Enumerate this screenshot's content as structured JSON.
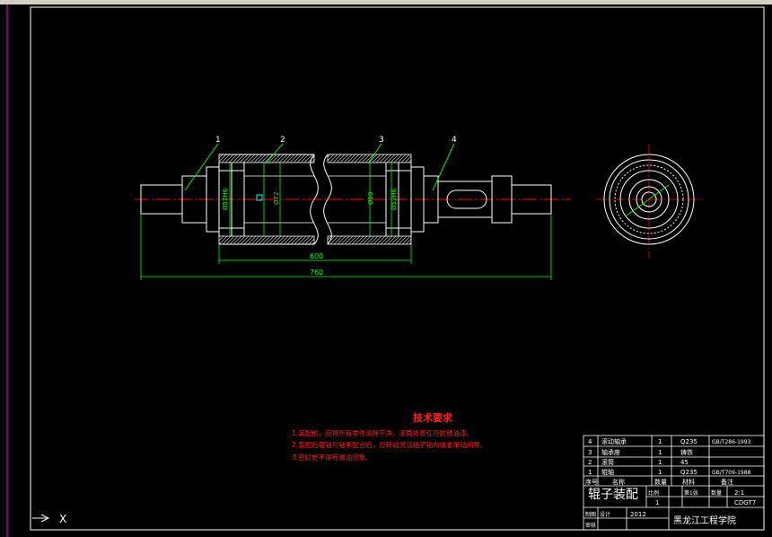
{
  "drawing": {
    "part_numbers": [
      "1",
      "2",
      "3",
      "4"
    ],
    "dimensions": {
      "tube_diameter": "Ø72",
      "left_hub_diameter": "Ø52H6",
      "bore_diameter": "Ø60",
      "right_hub_diameter": "Ø52H6",
      "tube_length": "600",
      "overall_length": "760"
    }
  },
  "requirements": {
    "title": "技术要求",
    "items": [
      "1.装配前，应将所有零件清除干净，滚筒外表红丹防锈油漆。",
      "2.装配后辊轴与轴承配合后，应转动灵活轴子轴向或者窜动间隙。",
      "3.密封处不得有漏油现象。"
    ]
  },
  "title_block": {
    "bom": [
      {
        "no": "4",
        "name": "滚动轴承",
        "qty": "1",
        "material": "Q235",
        "standard": "GB/T286-1993"
      },
      {
        "no": "3",
        "name": "轴承座",
        "qty": "1",
        "material": "铸铁",
        "standard": ""
      },
      {
        "no": "2",
        "name": "滚筒",
        "qty": "1",
        "material": "45",
        "standard": ""
      },
      {
        "no": "1",
        "name": "辊轴",
        "qty": "1",
        "material": "Q235",
        "standard": "GB/T709-1988"
      }
    ],
    "header": {
      "no": "序号",
      "name": "名称",
      "qty": "数量",
      "material": "材料",
      "note": "备注"
    },
    "drawing_name": "辊子装配",
    "scale_label": "比例",
    "scale": "2:1",
    "count_label": "数量",
    "count": "1",
    "sheet_label": "第1张",
    "drawing_no": "CDGT7",
    "drawn_label": "制图",
    "design_label": "设计",
    "check_label": "审核",
    "student_id": "2012",
    "school": "黑龙江工程学院"
  },
  "colors": {
    "background": "#000000",
    "outline": "#ffffff",
    "dimension": "#00ff00",
    "centerline": "#ff0000",
    "hatch": "#ffffff",
    "cyan": "#00ffff",
    "border_left": "#ff00ff",
    "requirement_text": "#ff2020"
  },
  "ui": {
    "ucs_x": "X"
  }
}
